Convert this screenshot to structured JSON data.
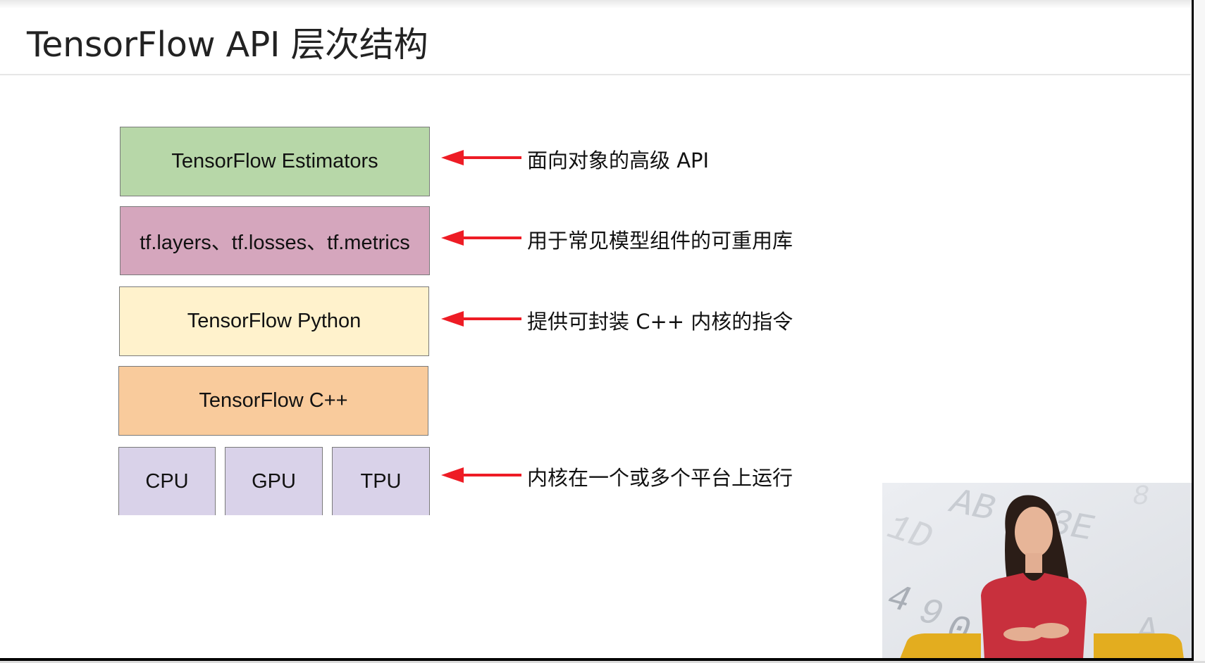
{
  "slide": {
    "title": "TensorFlow API 层次结构"
  },
  "colors": {
    "estimators": "#b7d7a8",
    "libraries": "#d5a6bd",
    "python": "#fff2cc",
    "cpp": "#f9cb9c",
    "hardware": "#d9d2e9",
    "arrow": "#ee1c25"
  },
  "layers": [
    {
      "label": "TensorFlow Estimators",
      "note": "面向对象的高级 API"
    },
    {
      "label": "tf.layers、tf.losses、tf.metrics",
      "note": "用于常见模型组件的可重用库"
    },
    {
      "label": "TensorFlow Python",
      "note": "提供可封装 C++ 内核的指令"
    },
    {
      "label": "TensorFlow C++",
      "note": ""
    }
  ],
  "hardware": {
    "items": [
      "CPU",
      "GPU",
      "TPU"
    ],
    "note": "内核在一个或多个平台上运行"
  },
  "video": {
    "description": "presenter-video-thumbnail",
    "background_letters": [
      "AB",
      "1D",
      "3E",
      "8",
      "4",
      "9",
      "0",
      "A"
    ]
  }
}
